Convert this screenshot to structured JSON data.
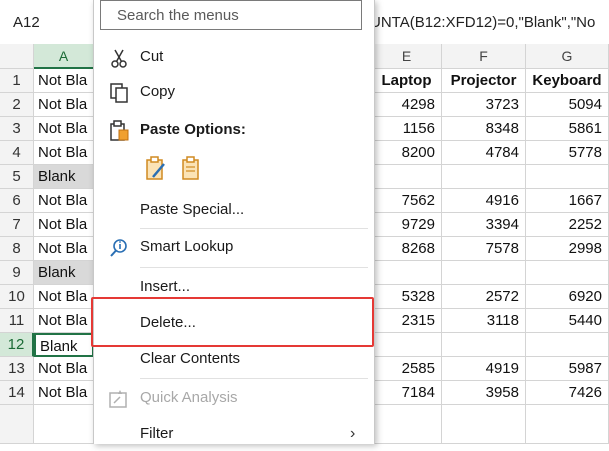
{
  "formula_bar": {
    "name_box": "A12",
    "formula_fragment": "UNTA(B12:XFD12)=0,\"Blank\",\"No"
  },
  "columns": {
    "a": "A",
    "e": "E",
    "f": "F",
    "g": "G"
  },
  "table_headers": {
    "e": "Laptop",
    "f": "Projector",
    "g": "Keyboard"
  },
  "rows": [
    {
      "num": "1",
      "a": "Not Bla",
      "e": "",
      "f": "",
      "g": ""
    },
    {
      "num": "2",
      "a": "Not Bla",
      "e": "4298",
      "f": "3723",
      "g": "5094"
    },
    {
      "num": "3",
      "a": "Not Bla",
      "e": "1156",
      "f": "8348",
      "g": "5861"
    },
    {
      "num": "4",
      "a": "Not Bla",
      "e": "8200",
      "f": "4784",
      "g": "5778"
    },
    {
      "num": "5",
      "a": "Blank",
      "e": "",
      "f": "",
      "g": ""
    },
    {
      "num": "6",
      "a": "Not Bla",
      "e": "7562",
      "f": "4916",
      "g": "1667"
    },
    {
      "num": "7",
      "a": "Not Bla",
      "e": "9729",
      "f": "3394",
      "g": "2252"
    },
    {
      "num": "8",
      "a": "Not Bla",
      "e": "8268",
      "f": "7578",
      "g": "2998"
    },
    {
      "num": "9",
      "a": "Blank",
      "e": "",
      "f": "",
      "g": ""
    },
    {
      "num": "10",
      "a": "Not Bla",
      "e": "5328",
      "f": "2572",
      "g": "6920"
    },
    {
      "num": "11",
      "a": "Not Bla",
      "e": "2315",
      "f": "3118",
      "g": "5440"
    },
    {
      "num": "12",
      "a": "Blank",
      "e": "",
      "f": "",
      "g": ""
    },
    {
      "num": "13",
      "a": "Not Bla",
      "e": "2585",
      "f": "4919",
      "g": "5987"
    },
    {
      "num": "14",
      "a": "Not Bla",
      "e": "7184",
      "f": "3958",
      "g": "7426"
    }
  ],
  "menu": {
    "search_placeholder": "Search the menus",
    "cut": "Cut",
    "copy": "Copy",
    "paste_options": "Paste Options:",
    "paste_special": "Paste Special...",
    "smart_lookup": "Smart Lookup",
    "insert": "Insert...",
    "delete": "Delete...",
    "clear_contents": "Clear Contents",
    "quick_analysis": "Quick Analysis",
    "filter": "Filter"
  },
  "colors": {
    "highlight": "#e53935",
    "excel_green": "#217346",
    "blank_fill": "#d9d9d9"
  }
}
